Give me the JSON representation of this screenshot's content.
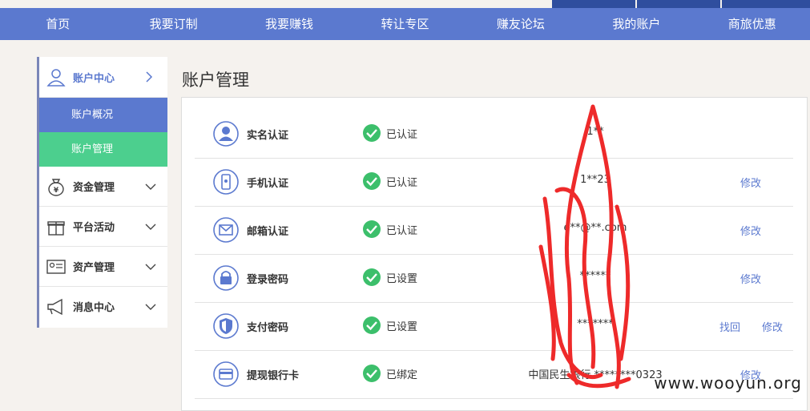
{
  "nav": [
    "首页",
    "我要订制",
    "我要赚钱",
    "转让专区",
    "赚友论坛",
    "我的账户",
    "商旅优惠"
  ],
  "sidebar": {
    "head": "账户中心",
    "subs": [
      "账户概况",
      "账户管理"
    ],
    "items": [
      "资金管理",
      "平台活动",
      "资产管理",
      "消息中心"
    ]
  },
  "page_title": "账户管理",
  "rows": [
    {
      "label": "实名认证",
      "status": "已认证",
      "value": "1**",
      "actions": []
    },
    {
      "label": "手机认证",
      "status": "已认证",
      "value": "1**23",
      "actions": [
        "修改"
      ]
    },
    {
      "label": "邮箱认证",
      "status": "已认证",
      "value": "e**@**.com",
      "actions": [
        "修改"
      ]
    },
    {
      "label": "登录密码",
      "status": "已设置",
      "value": "******",
      "actions": [
        "修改"
      ]
    },
    {
      "label": "支付密码",
      "status": "已设置",
      "value": "*******",
      "actions": [
        "找回",
        "修改"
      ]
    },
    {
      "label": "提现银行卡",
      "status": "已绑定",
      "value": "中国民生银行 ********0323",
      "actions": [
        "修改"
      ]
    }
  ],
  "watermark": "www.wooyun.org",
  "colors": {
    "nav": "#5b79cf",
    "active_sub": "#4ccf8e",
    "check": "#3cbf6b",
    "scribble": "#ee2a2a"
  }
}
